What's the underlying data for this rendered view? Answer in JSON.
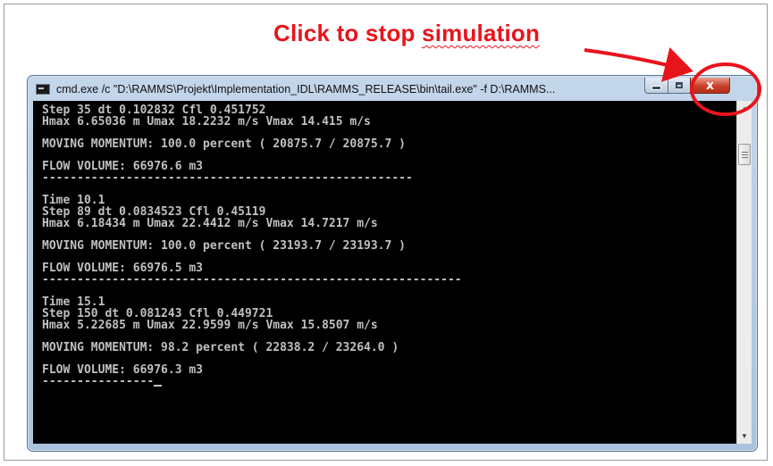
{
  "annotation": {
    "text_prefix": "Click to stop ",
    "text_underlined": "simulation",
    "color": "#e8141c"
  },
  "window": {
    "title": "cmd.exe /c  \"D:\\RAMMS\\Projekt\\Implementation_IDL\\RAMMS_RELEASE\\bin\\tail.exe\" -f D:\\RAMMS...",
    "icon": "console-app-icon",
    "controls": {
      "minimize_icon": "minimize-icon",
      "maximize_icon": "maximize-icon",
      "close_glyph": "x"
    }
  },
  "console": {
    "lines": [
      "Step 35 dt 0.102832 Cfl 0.451752",
      "Hmax 6.65036 m Umax 18.2232 m/s Vmax 14.415 m/s",
      "",
      "MOVING MOMENTUM: 100.0 percent ( 20875.7 / 20875.7 )",
      "",
      "FLOW VOLUME: 66976.6 m3",
      "-----------------------------------------------------",
      "",
      "Time 10.1",
      "Step 89 dt 0.0834523 Cfl 0.45119",
      "Hmax 6.18434 m Umax 22.4412 m/s Vmax 14.7217 m/s",
      "",
      "MOVING MOMENTUM: 100.0 percent ( 23193.7 / 23193.7 )",
      "",
      "FLOW VOLUME: 66976.5 m3",
      "------------------------------------------------------------",
      "",
      "Time 15.1",
      "Step 150 dt 0.081243 Cfl 0.449721",
      "Hmax 5.22685 m Umax 22.9599 m/s Vmax 15.8507 m/s",
      "",
      "MOVING MOMENTUM: 98.2 percent ( 22838.2 / 23264.0 )",
      "",
      "FLOW VOLUME: 66976.3 m3",
      "----------------"
    ]
  },
  "scrollbar": {
    "up_icon": "scroll-up-arrow-icon",
    "down_icon": "scroll-down-arrow-icon"
  }
}
